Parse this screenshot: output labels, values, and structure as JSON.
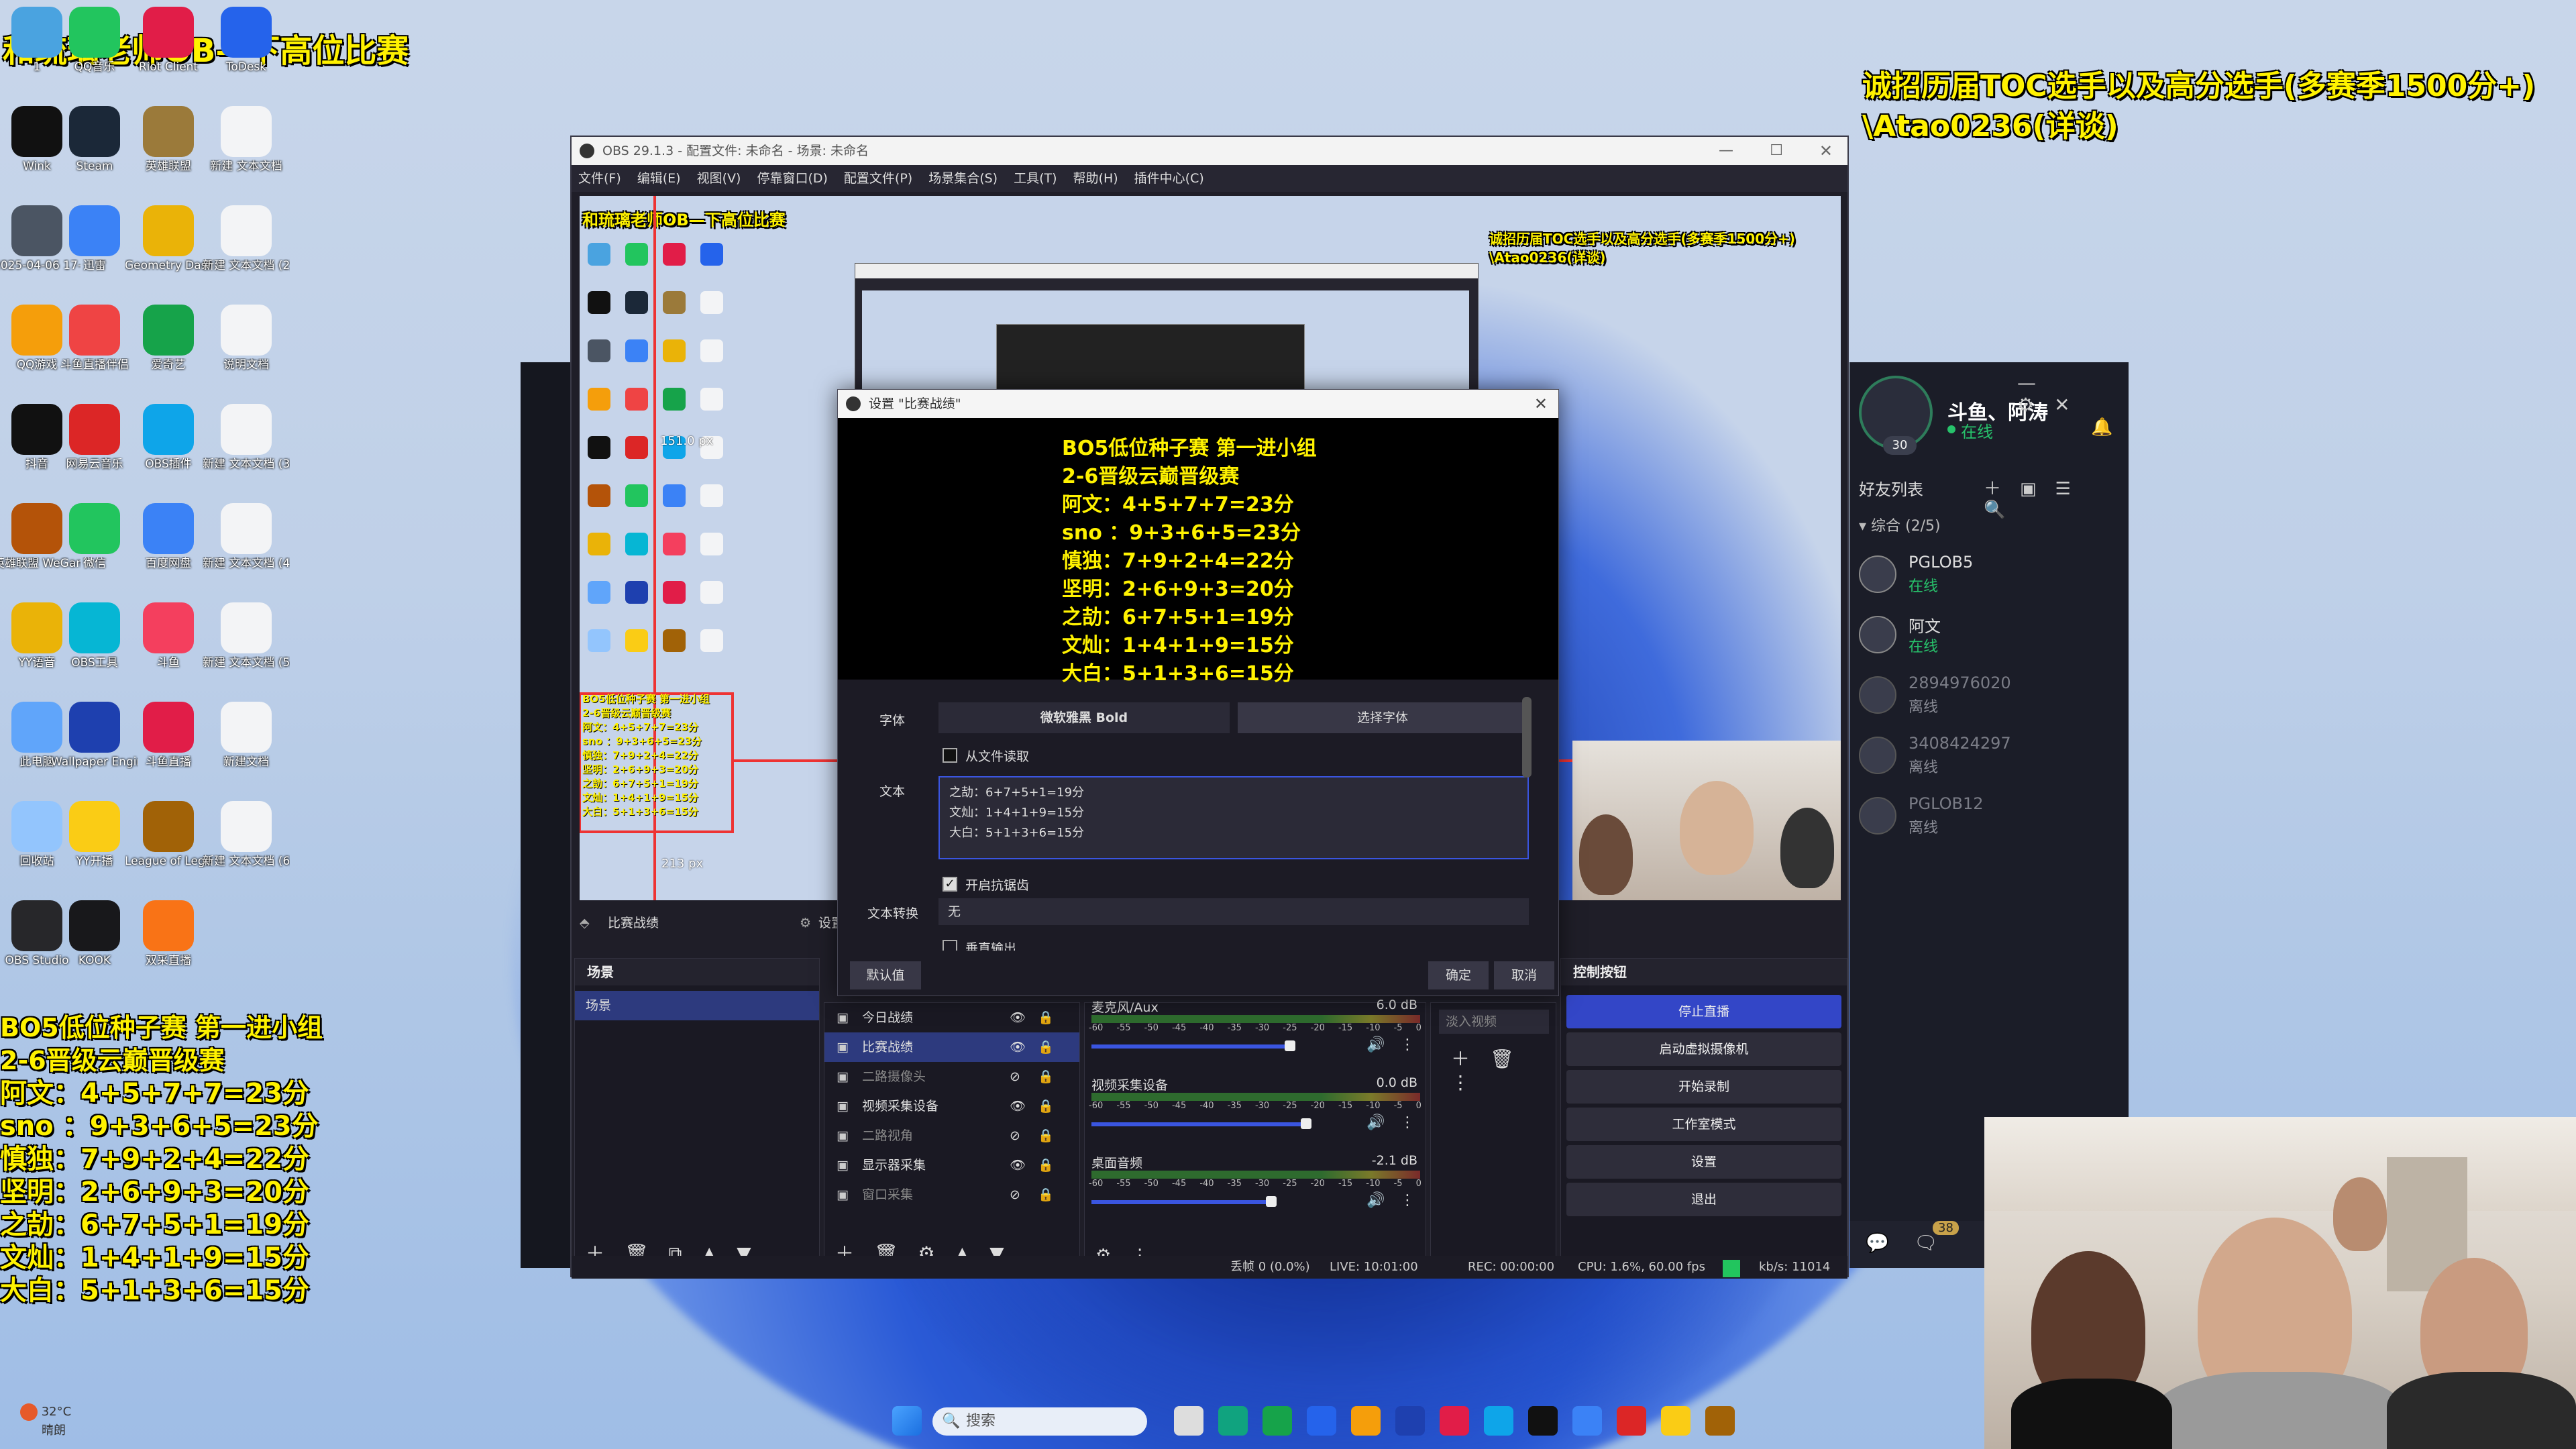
{
  "desktop": {
    "top_left_title": "和琉璃老师OB—下高位比赛",
    "top_right_recruit": "诚招历届TOC选手以及高分选手(多赛季1500分+)",
    "top_right_contact": "\\Atao0236(详谈)",
    "overlay_lines": [
      "BO5低位种子赛 第一进小组",
      "2-6晋级云巅晋级赛",
      "阿文：4+5+7+7=23分",
      "sno ：9+3+6+5=23分",
      "慎独：7+9+2+4=22分",
      "坚明：2+6+9+3=20分",
      "之劼：6+7+5+1=19分",
      "文灿：1+4+1+9=15分",
      "大白：5+1+3+6=15分"
    ],
    "icons": [
      {
        "label": "1",
        "color": "#4aa3e0"
      },
      {
        "label": "QQ音乐",
        "color": "#22c55e"
      },
      {
        "label": "Riot Client",
        "color": "#e11d48"
      },
      {
        "label": "ToDesk",
        "color": "#2563eb"
      },
      {
        "label": "Wink",
        "color": "#111111"
      },
      {
        "label": "Steam",
        "color": "#1b2838"
      },
      {
        "label": "英雄联盟",
        "color": "#9b7a3a"
      },
      {
        "label": "新建 文本文档",
        "color": "#f3f4f6"
      },
      {
        "label": "2025-04-06 17-30-34",
        "color": "#4b5563"
      },
      {
        "label": "迅雷",
        "color": "#3b82f6"
      },
      {
        "label": "Geometry Dash",
        "color": "#eab308"
      },
      {
        "label": "新建 文本文档 (2)",
        "color": "#f3f4f6"
      },
      {
        "label": "QQ游戏",
        "color": "#f59e0b"
      },
      {
        "label": "斗鱼直播伴侣",
        "color": "#ef4444"
      },
      {
        "label": "爱奇艺",
        "color": "#16a34a"
      },
      {
        "label": "说明文档",
        "color": "#f3f4f6"
      },
      {
        "label": "抖音",
        "color": "#111111"
      },
      {
        "label": "网易云音乐",
        "color": "#dc2626"
      },
      {
        "label": "OBS插件",
        "color": "#0ea5e9"
      },
      {
        "label": "新建 文本文档 (3)",
        "color": "#f3f4f6"
      },
      {
        "label": "英雄联盟 WeGame版",
        "color": "#b45309"
      },
      {
        "label": "微信",
        "color": "#22c55e"
      },
      {
        "label": "百度网盘",
        "color": "#3b82f6"
      },
      {
        "label": "新建 文本文档 (4)",
        "color": "#f3f4f6"
      },
      {
        "label": "YY语音",
        "color": "#eab308"
      },
      {
        "label": "OBS工具",
        "color": "#06b6d4"
      },
      {
        "label": "斗鱼",
        "color": "#f43f5e"
      },
      {
        "label": "新建 文本文档 (5)",
        "color": "#f3f4f6"
      },
      {
        "label": "此电脑",
        "color": "#60a5fa"
      },
      {
        "label": "Wallpaper Engine",
        "color": "#1e40af"
      },
      {
        "label": "斗鱼直播",
        "color": "#e11d48"
      },
      {
        "label": "新建文档",
        "color": "#f3f4f6"
      },
      {
        "label": "回收站",
        "color": "#93c5fd"
      },
      {
        "label": "YY开播",
        "color": "#facc15"
      },
      {
        "label": "League of Legends",
        "color": "#a16207"
      },
      {
        "label": "新建 文本文档 (6)",
        "color": "#f3f4f6"
      },
      {
        "label": "OBS Studio",
        "color": "#27272a"
      },
      {
        "label": "KOOK",
        "color": "#18181b"
      },
      {
        "label": "双采直播",
        "color": "#f97316"
      }
    ],
    "weather_temp": "32°C",
    "weather_desc": "晴朗",
    "taskbar_search": "搜索"
  },
  "obs": {
    "window_title": "OBS 29.1.3 - 配置文件: 未命名 - 场景: 未命名",
    "menu": [
      "文件(F)",
      "编辑(E)",
      "视图(V)",
      "停靠窗口(D)",
      "配置文件(P)",
      "场景集合(S)",
      "工具(T)",
      "帮助(H)",
      "插件中心(C)"
    ],
    "selected_source_label": "比赛战绩",
    "settings_label": "设置",
    "preview_dimension_top": "151.0 px",
    "preview_dimension_bottom": "213 px",
    "scenes_header": "场景",
    "scenes": [
      "场景"
    ],
    "sources": [
      {
        "name": "今日战绩",
        "visible": true
      },
      {
        "name": "比赛战绩",
        "visible": true
      },
      {
        "name": "二路摄像头",
        "visible": false
      },
      {
        "name": "视频采集设备",
        "visible": true
      },
      {
        "name": "二路视角",
        "visible": false
      },
      {
        "name": "显示器采集",
        "visible": true
      },
      {
        "name": "窗口采集",
        "visible": false
      }
    ],
    "mixer": [
      {
        "name": "麦克风/Aux",
        "db": "6.0 dB",
        "level": 0.72
      },
      {
        "name": "视频采集设备",
        "db": "0.0 dB",
        "level": 0.78
      },
      {
        "name": "桌面音频",
        "db": "-2.1 dB",
        "level": 0.65
      }
    ],
    "meter_ticks": [
      "-60",
      "-55",
      "-50",
      "-45",
      "-40",
      "-35",
      "-30",
      "-25",
      "-20",
      "-15",
      "-10",
      "-5",
      "0"
    ],
    "transition_placeholder": "淡入视频",
    "controls_header": "控制按钮",
    "controls": [
      "停止直播",
      "启动虚拟摄像机",
      "开始录制",
      "工作室模式",
      "设置",
      "退出"
    ],
    "status": {
      "dropped": "丢帧 0 (0.0%)",
      "live": "LIVE: 10:01:00",
      "rec": "REC: 00:00:00",
      "cpu": "CPU: 1.6%, 60.00 fps",
      "kbps": "kb/s: 11014"
    }
  },
  "dialog": {
    "title": "设置 \"比赛战绩\"",
    "preview_lines": [
      "BO5低位种子赛 第一进小组",
      "2-6晋级云巅晋级赛",
      "阿文：4+5+7+7=23分",
      "sno ：9+3+6+5=23分",
      "慎独：7+9+2+4=22分",
      "坚明：2+6+9+3=20分",
      "之劼：6+7+5+1=19分",
      "文灿：1+4+1+9=15分",
      "大白：5+1+3+6=15分"
    ],
    "font_label": "字体",
    "font_value": "微软雅黑 Bold",
    "choose_font": "选择字体",
    "read_from_file": "从文件读取",
    "text_label": "文本",
    "text_lines": [
      "之劼：6+7+5+1=19分",
      "文灿：1+4+1+9=15分",
      "大白：5+1+3+6=15分"
    ],
    "antialias": "开启抗锯齿",
    "transform_label": "文本转换",
    "transform_value": "无",
    "vertical": "垂直输出",
    "defaults": "默认值",
    "ok": "确定",
    "cancel": "取消"
  },
  "qq": {
    "user_name": "斗鱼、阿涛",
    "user_status": "在线",
    "level": "30",
    "friends_title": "好友列表",
    "group": "综合 (2/5)",
    "friends": [
      {
        "name": "PGLOB5",
        "status": "在线",
        "online": true
      },
      {
        "name": "阿文",
        "status": "在线",
        "online": true
      },
      {
        "name": "2894976020",
        "status": "离线",
        "online": false
      },
      {
        "name": "3408424297",
        "status": "离线",
        "online": false
      },
      {
        "name": "PGLOB12",
        "status": "离线",
        "online": false
      }
    ],
    "badge": "38"
  }
}
